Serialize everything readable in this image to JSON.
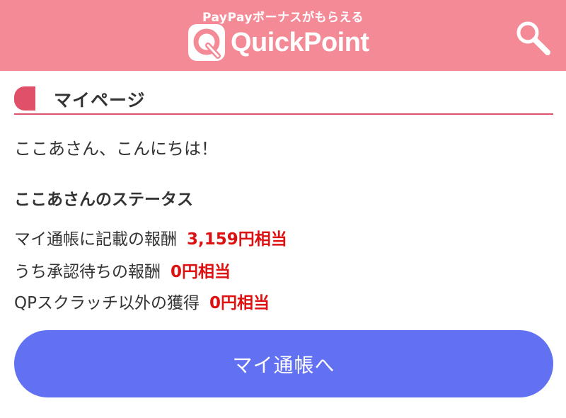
{
  "header": {
    "tagline": "PayPayボーナスがもらえる",
    "logo_text": "QuickPoint",
    "logo_mark": "Q",
    "search_icon": "search-icon",
    "bg_color": "#f58a97"
  },
  "section": {
    "title": "マイページ",
    "accent_color": "#e05069"
  },
  "greeting": "ここあさん、こんにちは！",
  "status": {
    "title": "ここあさんのステータス",
    "rows": [
      {
        "label": "マイ通帳に記載の報酬",
        "value": "3,159円相当"
      },
      {
        "label": "うち承認待ちの報酬",
        "value": "0円相当"
      },
      {
        "label": "QPスクラッチ以外の獲得",
        "value": "0円相当"
      }
    ],
    "value_color": "#dd1111"
  },
  "button": {
    "label": "マイ通帳へ",
    "color": "#6270f2"
  }
}
